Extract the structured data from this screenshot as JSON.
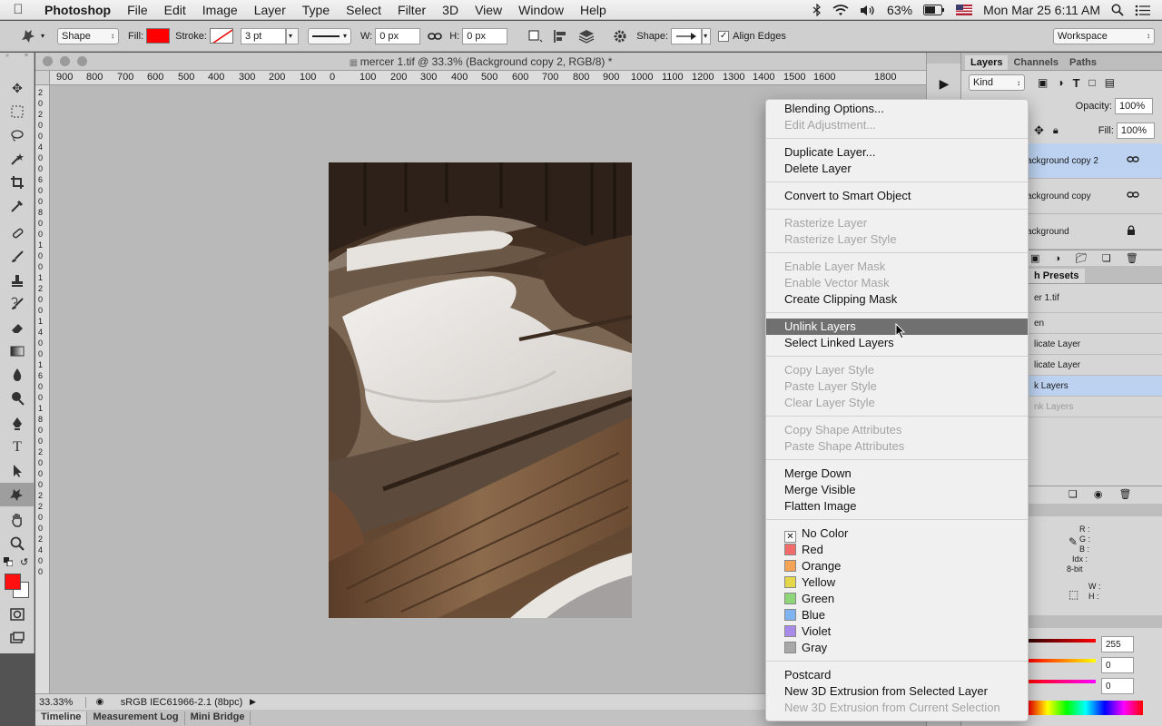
{
  "menubar": {
    "app_name": "Photoshop",
    "items": [
      "File",
      "Edit",
      "Image",
      "Layer",
      "Type",
      "Select",
      "Filter",
      "3D",
      "View",
      "Window",
      "Help"
    ],
    "battery": "63%",
    "datetime": "Mon Mar 25  6:11 AM"
  },
  "options": {
    "mode": "Shape",
    "fill_label": "Fill:",
    "fill_color": "#ff0000",
    "stroke_label": "Stroke:",
    "stroke_width": "3 pt",
    "w_label": "W:",
    "w_value": "0 px",
    "h_label": "H:",
    "h_value": "0 px",
    "shape_label": "Shape:",
    "align_edges": "Align Edges",
    "workspace": "Workspace"
  },
  "document": {
    "tab_title": "mercer 1.tif @ 33.3% (Background copy 2, RGB/8) *",
    "zoom": "33.33%",
    "profile": "sRGB IEC61966-2.1 (8bpc)"
  },
  "ruler": {
    "h_labels": [
      "900",
      "800",
      "700",
      "600",
      "500",
      "400",
      "300",
      "200",
      "100",
      "0",
      "100",
      "200",
      "300",
      "400",
      "500",
      "600",
      "700",
      "800",
      "900",
      "1000",
      "1100",
      "1200",
      "1300",
      "1400",
      "1500",
      "1600",
      "1800"
    ],
    "v_labels": [
      "2",
      "0",
      "2",
      "0",
      "0",
      "4",
      "0",
      "0",
      "6",
      "0",
      "0",
      "8",
      "0",
      "0",
      "1",
      "0",
      "0",
      "1",
      "2",
      "0",
      "0",
      "1",
      "4",
      "0",
      "0",
      "1",
      "6",
      "0",
      "0",
      "1",
      "8",
      "0",
      "0",
      "2",
      "0",
      "0",
      "0",
      "2",
      "2",
      "0",
      "0",
      "2",
      "4",
      "0",
      "0"
    ]
  },
  "bottom_tabs": [
    "Timeline",
    "Measurement Log",
    "Mini Bridge"
  ],
  "layers_panel": {
    "tabs": [
      "Layers",
      "Channels",
      "Paths"
    ],
    "kind": "Kind",
    "opacity_label": "Opacity:",
    "opacity": "100%",
    "fill_label": "Fill:",
    "fill": "100%",
    "layers": [
      "ackground copy 2",
      "ackground copy",
      "ackground"
    ]
  },
  "history_panel": {
    "tab": "h Presets",
    "items": [
      "er 1.tif",
      "en",
      "licate Layer",
      "licate Layer",
      "k Layers",
      "nk Layers"
    ]
  },
  "info_panel": {
    "r": "R :",
    "g": "G :",
    "b": "B :",
    "idx": "Idx :",
    "bit": "8-bit",
    "w": "W :",
    "h": "H :"
  },
  "color_panel": {
    "v1": "255",
    "v2": "0",
    "v3": "0"
  },
  "context_menu": {
    "items": [
      {
        "label": "Blending Options...",
        "enabled": true
      },
      {
        "label": "Edit Adjustment...",
        "enabled": false
      },
      {
        "sep": true
      },
      {
        "label": "Duplicate Layer...",
        "enabled": true
      },
      {
        "label": "Delete Layer",
        "enabled": true
      },
      {
        "sep": true
      },
      {
        "label": "Convert to Smart Object",
        "enabled": true
      },
      {
        "sep": true
      },
      {
        "label": "Rasterize Layer",
        "enabled": false
      },
      {
        "label": "Rasterize Layer Style",
        "enabled": false
      },
      {
        "sep": true
      },
      {
        "label": "Enable Layer Mask",
        "enabled": false
      },
      {
        "label": "Enable Vector Mask",
        "enabled": false
      },
      {
        "label": "Create Clipping Mask",
        "enabled": true
      },
      {
        "sep": true
      },
      {
        "label": "Unlink Layers",
        "enabled": true,
        "highlighted": true
      },
      {
        "label": "Select Linked Layers",
        "enabled": true
      },
      {
        "sep": true
      },
      {
        "label": "Copy Layer Style",
        "enabled": false
      },
      {
        "label": "Paste Layer Style",
        "enabled": false
      },
      {
        "label": "Clear Layer Style",
        "enabled": false
      },
      {
        "sep": true
      },
      {
        "label": "Copy Shape Attributes",
        "enabled": false
      },
      {
        "label": "Paste Shape Attributes",
        "enabled": false
      },
      {
        "sep": true
      },
      {
        "label": "Merge Down",
        "enabled": true
      },
      {
        "label": "Merge Visible",
        "enabled": true
      },
      {
        "label": "Flatten Image",
        "enabled": true
      },
      {
        "sep": true
      },
      {
        "label": "No Color",
        "enabled": true,
        "color": "none"
      },
      {
        "label": "Red",
        "enabled": true,
        "color": "#f26b6b"
      },
      {
        "label": "Orange",
        "enabled": true,
        "color": "#f5a455"
      },
      {
        "label": "Yellow",
        "enabled": true,
        "color": "#e6d64a"
      },
      {
        "label": "Green",
        "enabled": true,
        "color": "#8fd57a"
      },
      {
        "label": "Blue",
        "enabled": true,
        "color": "#7fb4f0"
      },
      {
        "label": "Violet",
        "enabled": true,
        "color": "#a88ae8"
      },
      {
        "label": "Gray",
        "enabled": true,
        "color": "#a8a8a8"
      },
      {
        "sep": true
      },
      {
        "label": "Postcard",
        "enabled": true
      },
      {
        "label": "New 3D Extrusion from Selected Layer",
        "enabled": true
      },
      {
        "label": "New 3D Extrusion from Current Selection",
        "enabled": false
      }
    ]
  },
  "tools": [
    "move-tool-icon",
    "marquee-tool-icon",
    "lasso-tool-icon",
    "quick-select-tool-icon",
    "crop-tool-icon",
    "eyedropper-tool-icon",
    "healing-brush-tool-icon",
    "brush-tool-icon",
    "clone-stamp-tool-icon",
    "history-brush-tool-icon",
    "eraser-tool-icon",
    "gradient-tool-icon",
    "blur-tool-icon",
    "dodge-tool-icon",
    "pen-tool-icon",
    "type-tool-icon",
    "path-select-tool-icon",
    "custom-shape-tool-icon",
    "hand-tool-icon",
    "zoom-tool-icon"
  ]
}
